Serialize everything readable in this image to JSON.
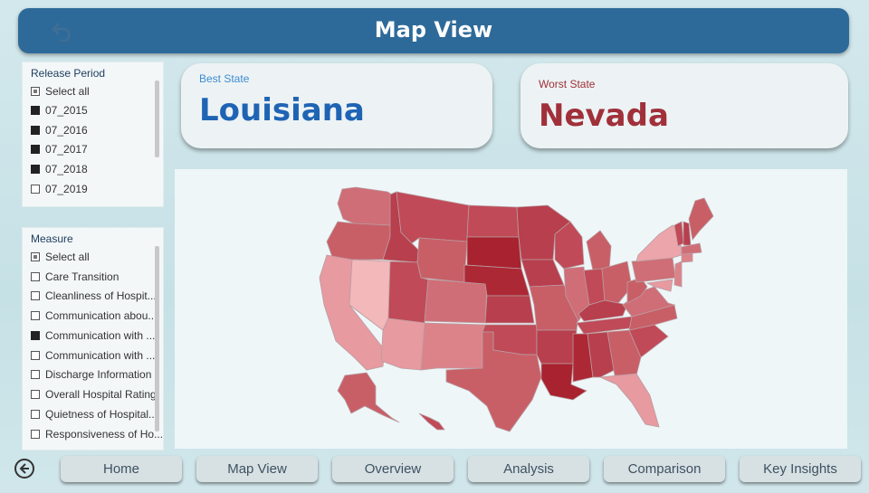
{
  "header": {
    "title": "Map View",
    "back_icon": "undo-arrow-icon"
  },
  "release_period": {
    "title": "Release Period",
    "items": [
      {
        "label": "Select all",
        "state": "partial"
      },
      {
        "label": "07_2015",
        "state": "checked"
      },
      {
        "label": "07_2016",
        "state": "checked"
      },
      {
        "label": "07_2017",
        "state": "checked"
      },
      {
        "label": "07_2018",
        "state": "checked"
      },
      {
        "label": "07_2019",
        "state": "unchecked"
      }
    ]
  },
  "measure": {
    "title": "Measure",
    "items": [
      {
        "label": "Select all",
        "state": "partial"
      },
      {
        "label": "Care Transition",
        "state": "unchecked"
      },
      {
        "label": "Cleanliness of Hospit...",
        "state": "unchecked"
      },
      {
        "label": "Communication abou...",
        "state": "unchecked"
      },
      {
        "label": "Communication with ...",
        "state": "checked"
      },
      {
        "label": "Communication with ...",
        "state": "unchecked"
      },
      {
        "label": "Discharge Information",
        "state": "unchecked"
      },
      {
        "label": "Overall Hospital Rating",
        "state": "unchecked"
      },
      {
        "label": "Quietness of Hospital...",
        "state": "unchecked"
      },
      {
        "label": "Responsiveness of Ho...",
        "state": "unchecked"
      }
    ]
  },
  "best_card": {
    "label": "Best State",
    "value": "Louisiana",
    "label_color": "#3d8bd0",
    "value_color": "#1f64b4"
  },
  "worst_card": {
    "label": "Worst State",
    "value": "Nevada",
    "label_color": "#a0303a",
    "value_color": "#a0303a"
  },
  "map": {
    "color_low": "#f0b7b9",
    "color_high": "#a8222f"
  },
  "nav": {
    "buttons": [
      "Home",
      "Map View",
      "Overview",
      "Analysis",
      "Comparison",
      "Key Insights"
    ],
    "back_icon": "circle-left-arrow-icon"
  }
}
